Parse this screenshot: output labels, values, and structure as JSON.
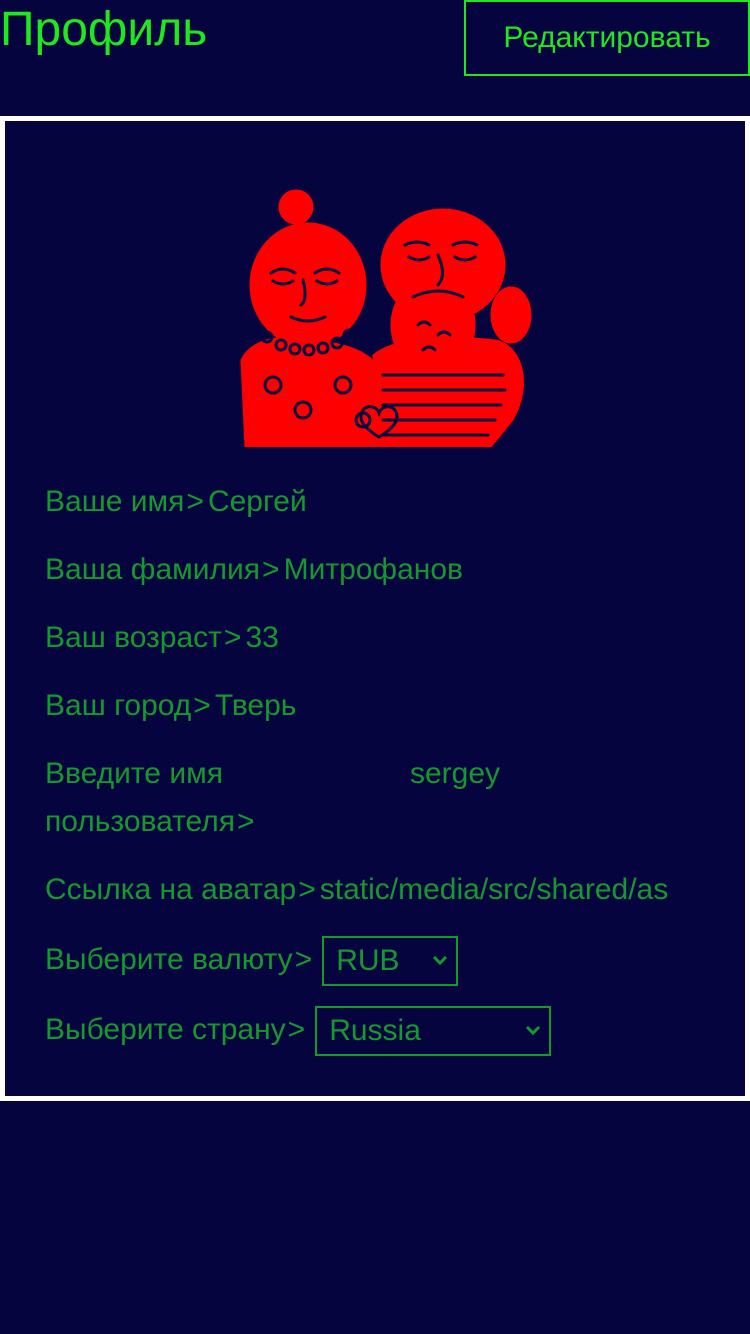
{
  "header": {
    "title": "Профиль",
    "edit_label": "Редактировать"
  },
  "colors": {
    "background": "#06043e",
    "accent_green": "#1ee81e",
    "text_green": "#149a2c",
    "avatar_red": "#ff0000",
    "card_border": "#ffffff"
  },
  "avatar": {
    "icon": "couple-illustration-icon"
  },
  "profile": {
    "separator": ">",
    "first_name": {
      "label": "Ваше имя",
      "value": "Сергей"
    },
    "last_name": {
      "label": "Ваша фамилия",
      "value": "Митрофанов"
    },
    "age": {
      "label": "Ваш возраст",
      "value": "33"
    },
    "city": {
      "label": "Ваш город",
      "value": "Тверь"
    },
    "username": {
      "label": "Введите имя пользователя",
      "value": "sergey"
    },
    "avatar_link": {
      "label": "Ссылка на аватар",
      "value": "static/media/src/shared/as"
    },
    "currency": {
      "label": "Выберите валюту",
      "selected": "RUB"
    },
    "country": {
      "label": "Выберите страну",
      "selected": "Russia"
    }
  }
}
